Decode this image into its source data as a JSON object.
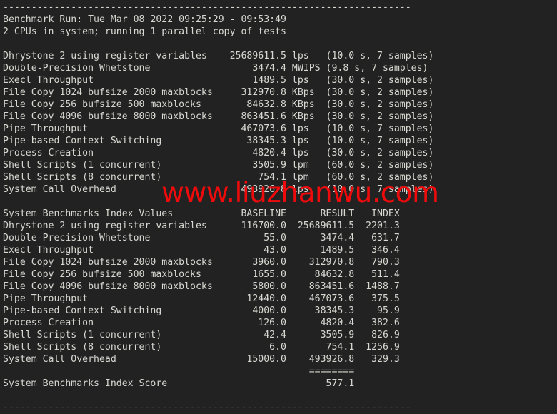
{
  "terminal": {
    "background_color": "#222222",
    "text_color": "#d8d8d2",
    "separator_top": "------------------------------------------------------------------------",
    "separator_bottom": "------------------------------------------------------------------------",
    "header": {
      "benchmark_run": "Benchmark Run: Tue Mar 08 2022 09:25:29 - 09:53:49",
      "cpu_info": "2 CPUs in system; running 1 parallel copy of tests"
    },
    "results": [
      {
        "name": "Dhrystone 2 using register variables",
        "value": "25689611.5",
        "unit": "lps",
        "detail": "(10.0 s, 7 samples)"
      },
      {
        "name": "Double-Precision Whetstone",
        "value": "3474.4",
        "unit": "MWIPS",
        "detail": "(9.8 s, 7 samples)"
      },
      {
        "name": "Execl Throughput",
        "value": "1489.5",
        "unit": "lps",
        "detail": "(30.0 s, 2 samples)"
      },
      {
        "name": "File Copy 1024 bufsize 2000 maxblocks",
        "value": "312970.8",
        "unit": "KBps",
        "detail": "(30.0 s, 2 samples)"
      },
      {
        "name": "File Copy 256 bufsize 500 maxblocks",
        "value": "84632.8",
        "unit": "KBps",
        "detail": "(30.0 s, 2 samples)"
      },
      {
        "name": "File Copy 4096 bufsize 8000 maxblocks",
        "value": "863451.6",
        "unit": "KBps",
        "detail": "(30.0 s, 2 samples)"
      },
      {
        "name": "Pipe Throughput",
        "value": "467073.6",
        "unit": "lps",
        "detail": "(10.0 s, 7 samples)"
      },
      {
        "name": "Pipe-based Context Switching",
        "value": "38345.3",
        "unit": "lps",
        "detail": "(10.0 s, 7 samples)"
      },
      {
        "name": "Process Creation",
        "value": "4820.4",
        "unit": "lps",
        "detail": "(30.0 s, 2 samples)"
      },
      {
        "name": "Shell Scripts (1 concurrent)",
        "value": "3505.9",
        "unit": "lpm",
        "detail": "(60.0 s, 2 samples)"
      },
      {
        "name": "Shell Scripts (8 concurrent)",
        "value": "754.1",
        "unit": "lpm",
        "detail": "(60.0 s, 2 samples)"
      },
      {
        "name": "System Call Overhead",
        "value": "493926.8",
        "unit": "lps",
        "detail": "(10.0 s, 7 samples)"
      }
    ],
    "index_table": {
      "title": "System Benchmarks Index Values",
      "columns": [
        "BASELINE",
        "RESULT",
        "INDEX"
      ],
      "rows": [
        {
          "name": "Dhrystone 2 using register variables",
          "baseline": "116700.0",
          "result": "25689611.5",
          "index": "2201.3"
        },
        {
          "name": "Double-Precision Whetstone",
          "baseline": "55.0",
          "result": "3474.4",
          "index": "631.7"
        },
        {
          "name": "Execl Throughput",
          "baseline": "43.0",
          "result": "1489.5",
          "index": "346.4"
        },
        {
          "name": "File Copy 1024 bufsize 2000 maxblocks",
          "baseline": "3960.0",
          "result": "312970.8",
          "index": "790.3"
        },
        {
          "name": "File Copy 256 bufsize 500 maxblocks",
          "baseline": "1655.0",
          "result": "84632.8",
          "index": "511.4"
        },
        {
          "name": "File Copy 4096 bufsize 8000 maxblocks",
          "baseline": "5800.0",
          "result": "863451.6",
          "index": "1488.7"
        },
        {
          "name": "Pipe Throughput",
          "baseline": "12440.0",
          "result": "467073.6",
          "index": "375.5"
        },
        {
          "name": "Pipe-based Context Switching",
          "baseline": "4000.0",
          "result": "38345.3",
          "index": "95.9"
        },
        {
          "name": "Process Creation",
          "baseline": "126.0",
          "result": "4820.4",
          "index": "382.6"
        },
        {
          "name": "Shell Scripts (1 concurrent)",
          "baseline": "42.4",
          "result": "3505.9",
          "index": "826.9"
        },
        {
          "name": "Shell Scripts (8 concurrent)",
          "baseline": "6.0",
          "result": "754.1",
          "index": "1256.9"
        },
        {
          "name": "System Call Overhead",
          "baseline": "15000.0",
          "result": "493926.8",
          "index": "329.3"
        }
      ]
    },
    "score": {
      "rule": "========",
      "label": "System Benchmarks Index Score",
      "value": "577.1"
    }
  },
  "watermark": {
    "text": "www.liuzhanwu.com",
    "color": "#ef0b0b"
  }
}
